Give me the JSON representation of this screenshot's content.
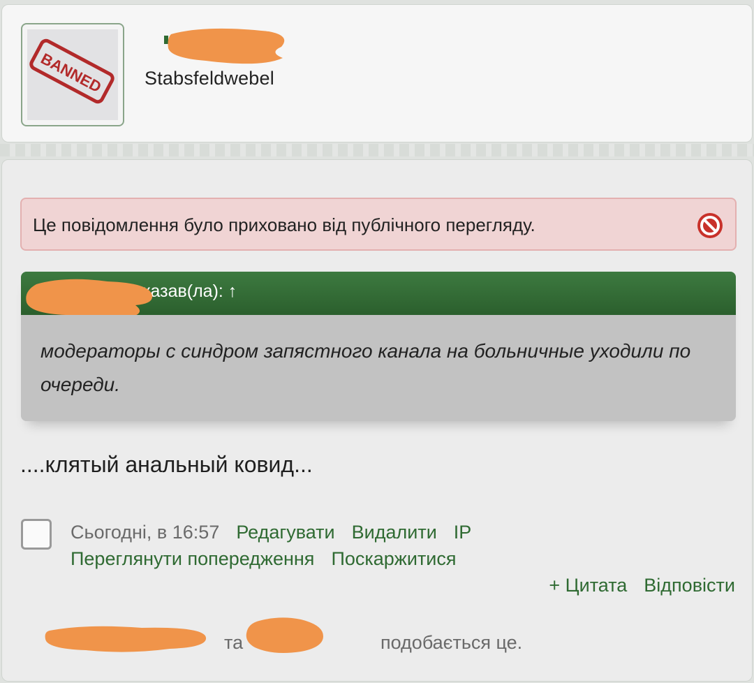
{
  "user": {
    "avatar_text": "BANNED",
    "title": "Stabsfeldwebel"
  },
  "post": {
    "hidden_notice": "Це повідомлення було приховано від публічного перегляду.",
    "quote": {
      "header_suffix": "казав(ла): ↑",
      "text": "модераторы с синдром запястного канала на больничные уходили по очереди."
    },
    "message": "....клятый анальный ковид...",
    "meta": {
      "date": "Сьогодні, в 16:57",
      "edit": "Редагувати",
      "delete": "Видалити",
      "ip": "IP",
      "view_warnings": "Переглянути попередження",
      "report": "Поскаржитися",
      "quote": "+ Цитата",
      "reply": "Відповісти"
    },
    "likes": {
      "connector": "та",
      "suffix": "подобається це."
    }
  },
  "colors": {
    "accent_green": "#2f6a32",
    "quote_header": "#2b5f2d",
    "notice_bg": "#f0d4d4",
    "redaction": "#f0944a"
  }
}
